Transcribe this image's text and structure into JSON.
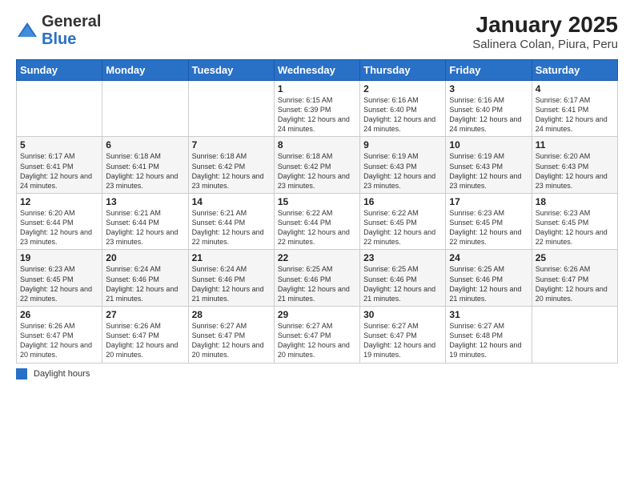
{
  "logo": {
    "general": "General",
    "blue": "Blue"
  },
  "title": "January 2025",
  "subtitle": "Salinera Colan, Piura, Peru",
  "days_of_week": [
    "Sunday",
    "Monday",
    "Tuesday",
    "Wednesday",
    "Thursday",
    "Friday",
    "Saturday"
  ],
  "weeks": [
    [
      {
        "day": "",
        "info": ""
      },
      {
        "day": "",
        "info": ""
      },
      {
        "day": "",
        "info": ""
      },
      {
        "day": "1",
        "info": "Sunrise: 6:15 AM\nSunset: 6:39 PM\nDaylight: 12 hours\nand 24 minutes."
      },
      {
        "day": "2",
        "info": "Sunrise: 6:16 AM\nSunset: 6:40 PM\nDaylight: 12 hours\nand 24 minutes."
      },
      {
        "day": "3",
        "info": "Sunrise: 6:16 AM\nSunset: 6:40 PM\nDaylight: 12 hours\nand 24 minutes."
      },
      {
        "day": "4",
        "info": "Sunrise: 6:17 AM\nSunset: 6:41 PM\nDaylight: 12 hours\nand 24 minutes."
      }
    ],
    [
      {
        "day": "5",
        "info": "Sunrise: 6:17 AM\nSunset: 6:41 PM\nDaylight: 12 hours\nand 24 minutes."
      },
      {
        "day": "6",
        "info": "Sunrise: 6:18 AM\nSunset: 6:41 PM\nDaylight: 12 hours\nand 23 minutes."
      },
      {
        "day": "7",
        "info": "Sunrise: 6:18 AM\nSunset: 6:42 PM\nDaylight: 12 hours\nand 23 minutes."
      },
      {
        "day": "8",
        "info": "Sunrise: 6:18 AM\nSunset: 6:42 PM\nDaylight: 12 hours\nand 23 minutes."
      },
      {
        "day": "9",
        "info": "Sunrise: 6:19 AM\nSunset: 6:43 PM\nDaylight: 12 hours\nand 23 minutes."
      },
      {
        "day": "10",
        "info": "Sunrise: 6:19 AM\nSunset: 6:43 PM\nDaylight: 12 hours\nand 23 minutes."
      },
      {
        "day": "11",
        "info": "Sunrise: 6:20 AM\nSunset: 6:43 PM\nDaylight: 12 hours\nand 23 minutes."
      }
    ],
    [
      {
        "day": "12",
        "info": "Sunrise: 6:20 AM\nSunset: 6:44 PM\nDaylight: 12 hours\nand 23 minutes."
      },
      {
        "day": "13",
        "info": "Sunrise: 6:21 AM\nSunset: 6:44 PM\nDaylight: 12 hours\nand 23 minutes."
      },
      {
        "day": "14",
        "info": "Sunrise: 6:21 AM\nSunset: 6:44 PM\nDaylight: 12 hours\nand 22 minutes."
      },
      {
        "day": "15",
        "info": "Sunrise: 6:22 AM\nSunset: 6:44 PM\nDaylight: 12 hours\nand 22 minutes."
      },
      {
        "day": "16",
        "info": "Sunrise: 6:22 AM\nSunset: 6:45 PM\nDaylight: 12 hours\nand 22 minutes."
      },
      {
        "day": "17",
        "info": "Sunrise: 6:23 AM\nSunset: 6:45 PM\nDaylight: 12 hours\nand 22 minutes."
      },
      {
        "day": "18",
        "info": "Sunrise: 6:23 AM\nSunset: 6:45 PM\nDaylight: 12 hours\nand 22 minutes."
      }
    ],
    [
      {
        "day": "19",
        "info": "Sunrise: 6:23 AM\nSunset: 6:45 PM\nDaylight: 12 hours\nand 22 minutes."
      },
      {
        "day": "20",
        "info": "Sunrise: 6:24 AM\nSunset: 6:46 PM\nDaylight: 12 hours\nand 21 minutes."
      },
      {
        "day": "21",
        "info": "Sunrise: 6:24 AM\nSunset: 6:46 PM\nDaylight: 12 hours\nand 21 minutes."
      },
      {
        "day": "22",
        "info": "Sunrise: 6:25 AM\nSunset: 6:46 PM\nDaylight: 12 hours\nand 21 minutes."
      },
      {
        "day": "23",
        "info": "Sunrise: 6:25 AM\nSunset: 6:46 PM\nDaylight: 12 hours\nand 21 minutes."
      },
      {
        "day": "24",
        "info": "Sunrise: 6:25 AM\nSunset: 6:46 PM\nDaylight: 12 hours\nand 21 minutes."
      },
      {
        "day": "25",
        "info": "Sunrise: 6:26 AM\nSunset: 6:47 PM\nDaylight: 12 hours\nand 20 minutes."
      }
    ],
    [
      {
        "day": "26",
        "info": "Sunrise: 6:26 AM\nSunset: 6:47 PM\nDaylight: 12 hours\nand 20 minutes."
      },
      {
        "day": "27",
        "info": "Sunrise: 6:26 AM\nSunset: 6:47 PM\nDaylight: 12 hours\nand 20 minutes."
      },
      {
        "day": "28",
        "info": "Sunrise: 6:27 AM\nSunset: 6:47 PM\nDaylight: 12 hours\nand 20 minutes."
      },
      {
        "day": "29",
        "info": "Sunrise: 6:27 AM\nSunset: 6:47 PM\nDaylight: 12 hours\nand 20 minutes."
      },
      {
        "day": "30",
        "info": "Sunrise: 6:27 AM\nSunset: 6:47 PM\nDaylight: 12 hours\nand 19 minutes."
      },
      {
        "day": "31",
        "info": "Sunrise: 6:27 AM\nSunset: 6:48 PM\nDaylight: 12 hours\nand 19 minutes."
      },
      {
        "day": "",
        "info": ""
      }
    ]
  ],
  "footer": {
    "legend_label": "Daylight hours"
  }
}
